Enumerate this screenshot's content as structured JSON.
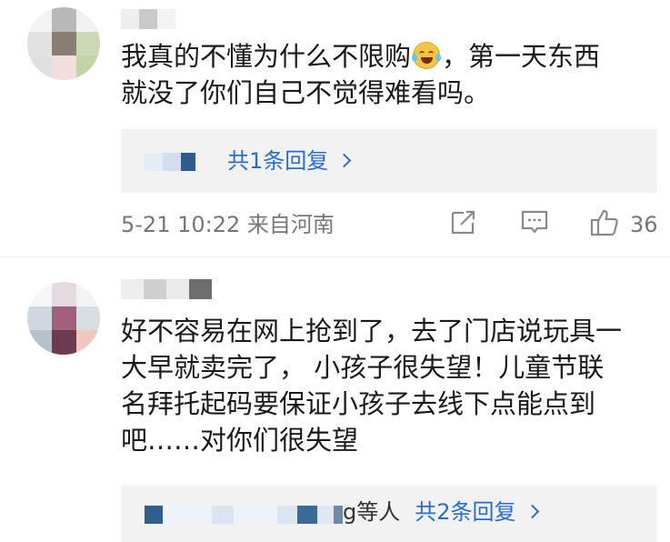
{
  "comments": [
    {
      "text_before_emoji": "我真的不懂为什么不限购",
      "text_after_emoji": "，第一天东西",
      "text_line2": "就没了你们自己不觉得难看吗。",
      "emoji": "laughing-tears-emoji",
      "replies_label": "共1条回复",
      "meta": "5-21 10:22 来自河南",
      "likes": "36"
    },
    {
      "lines": [
        "好不容易在网上抢到了，去了门店说玩具一",
        "大早就卖完了， 小孩子很失望！儿童节联",
        "名拜托起码要保证小孩子去线下点能点到",
        "吧……对你们很失望"
      ],
      "repliers_suffix": "g等人",
      "replies_label": "共2条回复"
    }
  ],
  "colors": {
    "link": "#2a6bd1",
    "meta": "#777777",
    "reply_bg": "#f2f2f2"
  }
}
